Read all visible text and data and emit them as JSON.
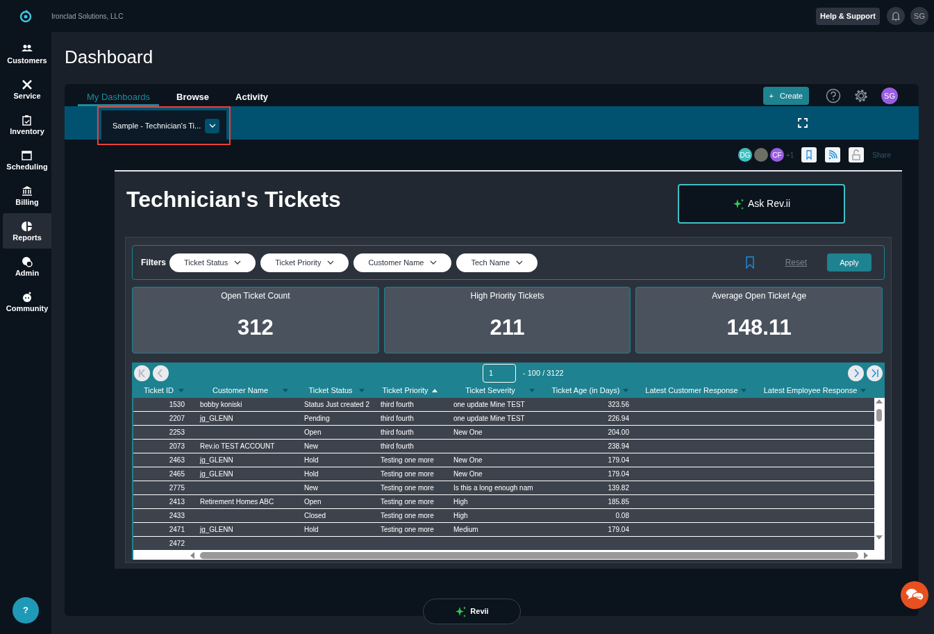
{
  "company": "Ironclad Solutions, LLC",
  "top_bar": {
    "help_button": "Help & Support",
    "user_initials": "SG"
  },
  "sidebar": {
    "items": [
      {
        "label": "Customers",
        "selected": false
      },
      {
        "label": "Service",
        "selected": false
      },
      {
        "label": "Inventory",
        "selected": false
      },
      {
        "label": "Scheduling",
        "selected": false
      },
      {
        "label": "Billing",
        "selected": false
      },
      {
        "label": "Reports",
        "selected": true
      },
      {
        "label": "Admin",
        "selected": false
      },
      {
        "label": "Community",
        "selected": false
      }
    ],
    "help_button": "?"
  },
  "page_title": "Dashboard",
  "tabs": [
    {
      "label": "My Dashboards",
      "selected": true
    },
    {
      "label": "Browse",
      "selected": false
    },
    {
      "label": "Activity",
      "selected": false
    }
  ],
  "toolbar": {
    "create_button": "Create",
    "create_icon": "+",
    "user_initials": "SG"
  },
  "dashboard_selector": {
    "label": "Sample - Technician's Ti...",
    "highlighted": true
  },
  "sharing": {
    "avatars": [
      {
        "kind": "initials",
        "text": "DG",
        "color": "#3fbfbf"
      },
      {
        "kind": "photo",
        "color": "#6b6f64"
      },
      {
        "kind": "initials",
        "text": "CF",
        "color": "#9a5de0"
      }
    ],
    "more": "+1",
    "share_label": "Share"
  },
  "report": {
    "title": "Technician's Tickets",
    "ask_button": "Ask Rev.ii",
    "filters": {
      "label": "Filters",
      "dropdowns": [
        "Ticket Status",
        "Ticket Priority",
        "Customer Name",
        "Tech Name"
      ],
      "reset": "Reset",
      "apply": "Apply"
    },
    "kpis": [
      {
        "title": "Open Ticket Count",
        "value": "312"
      },
      {
        "title": "High Priority Tickets",
        "value": "211"
      },
      {
        "title": "Average Open Ticket Age",
        "value": "148.11"
      }
    ],
    "table": {
      "page": "1",
      "range": "- 100 / 3122",
      "columns": [
        {
          "label": "Ticket ID",
          "sorted": false
        },
        {
          "label": "Customer Name",
          "sorted": false
        },
        {
          "label": "Ticket Status",
          "sorted": false
        },
        {
          "label": "Ticket Priority",
          "sorted": true
        },
        {
          "label": "Ticket Severity",
          "sorted": false
        },
        {
          "label": "Ticket Age (in Days)",
          "sorted": false
        },
        {
          "label": "Latest Customer Response",
          "sorted": false
        },
        {
          "label": "Latest Employee Response",
          "sorted": false
        }
      ],
      "rows": [
        {
          "cells": {
            "0": "1530",
            "1": "bobby koniski",
            "2": "Status Just created 2",
            "3": "third fourth",
            "4": "one update Mine TEST",
            "5": "323.56"
          }
        },
        {
          "cells": {
            "0": "2207",
            "1": "jg_GLENN",
            "2": "Pending",
            "3": "third fourth",
            "4": "one update Mine TEST",
            "5": "226.94"
          }
        },
        {
          "cells": {
            "0": "2253",
            "2": "Open",
            "3": "third fourth",
            "4": "New One",
            "5": "204.00"
          }
        },
        {
          "cells": {
            "0": "2073",
            "1": "Rev.io TEST ACCOUNT",
            "2": "New",
            "3": "third fourth",
            "5": "238.94"
          }
        },
        {
          "cells": {
            "0": "2463",
            "1": "jg_GLENN",
            "2": "Hold",
            "3": "Testing one more",
            "4": "New One",
            "5": "179.04"
          }
        },
        {
          "cells": {
            "0": "2465",
            "1": "jg_GLENN",
            "2": "Hold",
            "3": "Testing one more",
            "4": "New One",
            "5": "179.04"
          }
        },
        {
          "cells": {
            "0": "2775",
            "2": "New",
            "3": "Testing one more",
            "4": "Is this a long enough nam",
            "5": "139.82"
          }
        },
        {
          "cells": {
            "0": "2413",
            "1": "Retirement Homes ABC",
            "2": "Open",
            "3": "Testing one more",
            "4": "High",
            "5": "185.85"
          }
        },
        {
          "cells": {
            "0": "2433",
            "2": "Closed",
            "3": "Testing one more",
            "4": "High",
            "5": "0.08"
          }
        },
        {
          "cells": {
            "0": "2471",
            "1": "jg_GLENN",
            "2": "Hold",
            "3": "Testing one more",
            "4": "Medium",
            "5": "179.04"
          }
        },
        {
          "cells": {
            "0": "2472"
          }
        }
      ]
    }
  },
  "assistant_button": "Revii"
}
